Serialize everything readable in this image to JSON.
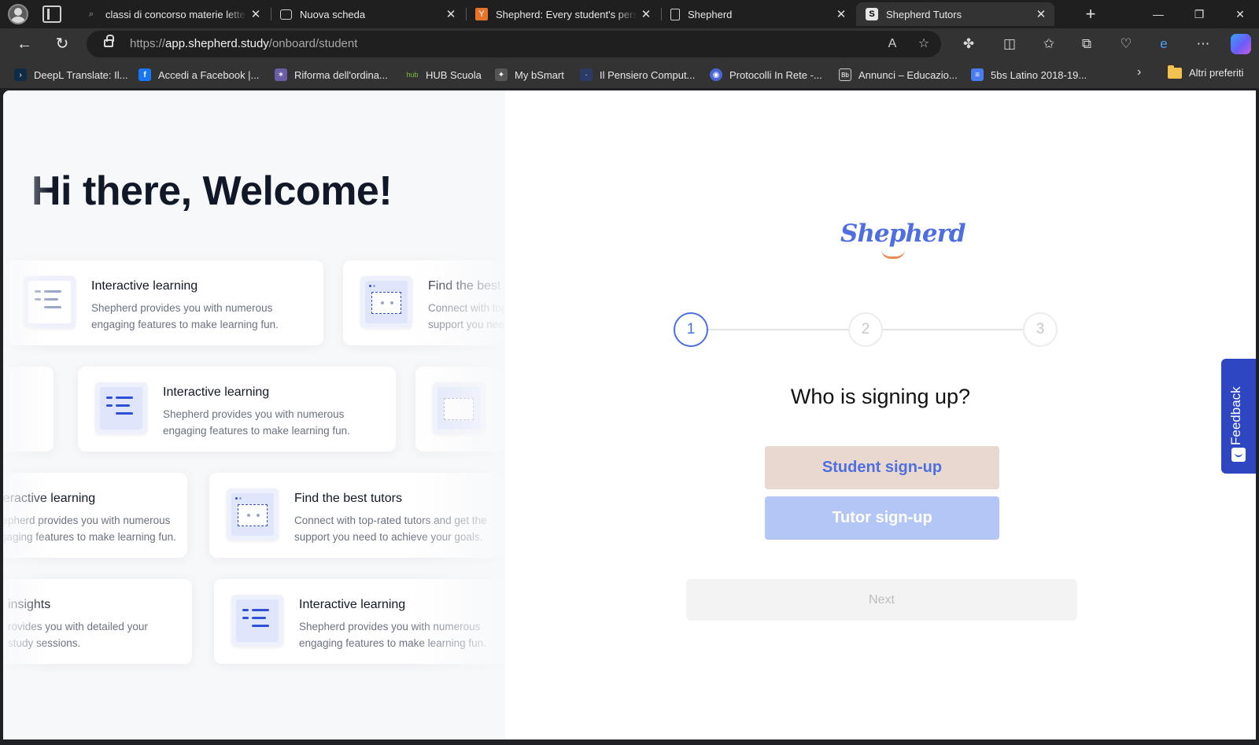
{
  "browser": {
    "tabs": [
      {
        "title": "classi di concorso materie lette",
        "favicon": "search-icon",
        "active": false
      },
      {
        "title": "Nuova scheda",
        "favicon": "newtab-icon",
        "active": false
      },
      {
        "title": "Shepherd: Every student's pers",
        "favicon": "Y",
        "active": false
      },
      {
        "title": "Shepherd",
        "favicon": "page-icon",
        "active": false
      },
      {
        "title": "Shepherd Tutors",
        "favicon": "S",
        "active": true
      }
    ],
    "address": {
      "scheme": "https://",
      "host": "app.shepherd.study",
      "path": "/onboard/student"
    },
    "bookmarks": [
      {
        "label": "DeepL Translate: Il...",
        "icon_color": "#0f2b46",
        "glyph": "›"
      },
      {
        "label": "Accedi a Facebook |...",
        "icon_color": "#1877f2",
        "glyph": "f"
      },
      {
        "label": "Riforma dell'ordina...",
        "icon_color": "#6b5ca5",
        "glyph": "✶"
      },
      {
        "label": "HUB Scuola",
        "icon_color": "#7fbf3f",
        "glyph": "hub"
      },
      {
        "label": "My bSmart",
        "icon_color": "#555555",
        "glyph": "✦"
      },
      {
        "label": "Il Pensiero Comput...",
        "icon_color": "#2b3a67",
        "glyph": "·"
      },
      {
        "label": "Protocolli In Rete -...",
        "icon_color": "#4a66d8",
        "glyph": "◉"
      },
      {
        "label": "Annunci – Educazio...",
        "icon_color": "#3a3a3a",
        "glyph": "Bb"
      },
      {
        "label": "5bs Latino 2018-19...",
        "icon_color": "#4a7cf0",
        "glyph": "≡"
      }
    ],
    "other_bookmarks": "Altri preferiti"
  },
  "page": {
    "welcome": "Hi there, Welcome!",
    "cards": [
      {
        "title": "Interactive learning",
        "desc": "Shepherd provides you with numerous engaging features to make learning fun."
      },
      {
        "title": "Find the best tutors",
        "desc": "Connect with top-rated tutors and get the support you need to achieve your goals."
      },
      {
        "title": "Interactive learning",
        "desc": "Shepherd provides you with numerous engaging features to make learning fun."
      },
      {
        "title": "Interactive learning",
        "desc": "Shepherd provides you with numerous engaging features to make learning fun."
      },
      {
        "title": "Find the best tutors",
        "desc": "Connect with top-rated tutors and get the support you need to achieve your goals."
      },
      {
        "title": "insights",
        "desc": "rovides you with detailed your study sessions."
      },
      {
        "title": "Interactive learning",
        "desc": "Shepherd provides you with numerous engaging features to make learning fun."
      }
    ],
    "logo": "Shepherd",
    "steps": [
      "1",
      "2",
      "3"
    ],
    "question": "Who is signing up?",
    "student_button": "Student sign-up",
    "tutor_button": "Tutor sign-up",
    "next_button": "Next",
    "feedback": "Feedback"
  }
}
